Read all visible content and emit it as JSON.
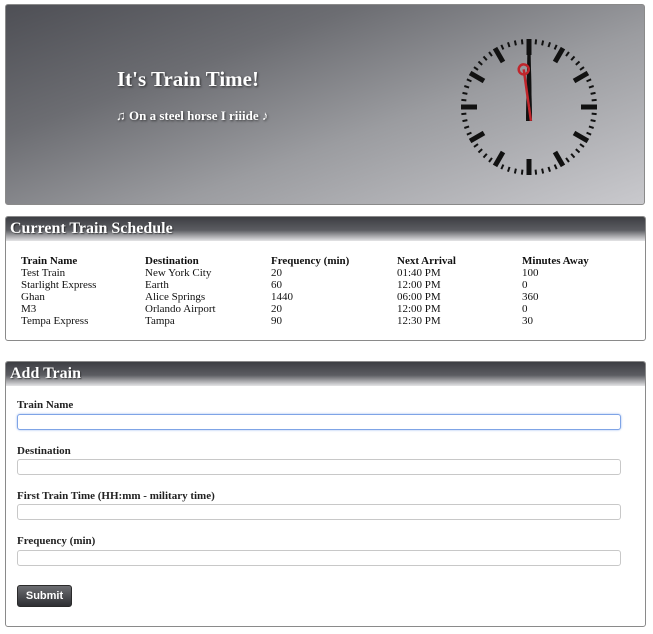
{
  "header": {
    "title": "It's Train Time!",
    "subtitle": "♫ On a steel horse I riiide ♪"
  },
  "clock": {
    "time": "12:00:16"
  },
  "schedule": {
    "heading": "Current Train Schedule",
    "columns": [
      "Train Name",
      "Destination",
      "Frequency (min)",
      "Next Arrival",
      "Minutes Away"
    ],
    "rows": [
      [
        "Test Train",
        "New York City",
        "20",
        "01:40 PM",
        "100"
      ],
      [
        "Starlight Express",
        "Earth",
        "60",
        "12:00 PM",
        "0"
      ],
      [
        "Ghan",
        "Alice Springs",
        "1440",
        "06:00 PM",
        "360"
      ],
      [
        "M3",
        "Orlando Airport",
        "20",
        "12:00 PM",
        "0"
      ],
      [
        "Tempa Express",
        "Tampa",
        "90",
        "12:30 PM",
        "30"
      ]
    ]
  },
  "form": {
    "heading": "Add Train",
    "train_name_label": "Train Name",
    "train_name_value": "",
    "destination_label": "Destination",
    "destination_value": "",
    "first_time_label": "First Train Time (HH:mm - military time)",
    "first_time_value": "",
    "frequency_label": "Frequency (min)",
    "frequency_value": "",
    "submit_label": "Submit"
  },
  "colors": {
    "header_gradient_dark": "#4e4f55",
    "header_gradient_light": "#c9c9cd",
    "panel_head_dark": "#3d3e43",
    "clock_second_hand": "#c0262c",
    "focus_border": "#7fa4e6"
  }
}
